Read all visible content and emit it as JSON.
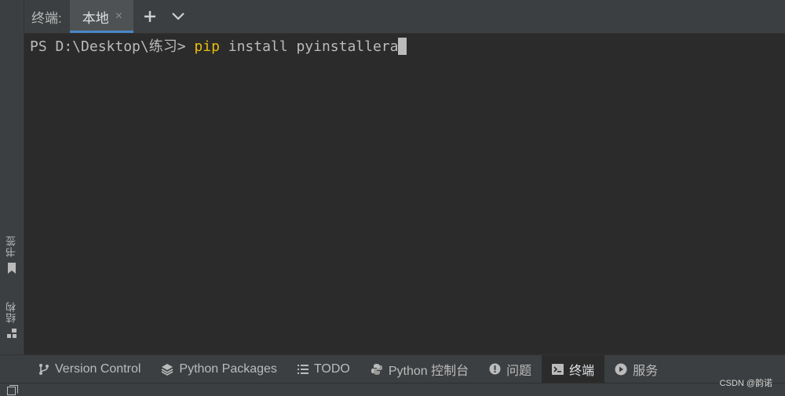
{
  "header": {
    "title": "终端:",
    "tab_label": "本地",
    "tab_close": "×"
  },
  "terminal": {
    "prompt": "PS D:\\Desktop\\练习> ",
    "command": "pip",
    "args": " install pyinstallera"
  },
  "left_tools": [
    {
      "label": "书签",
      "icon": "bookmark-icon"
    },
    {
      "label": "结构",
      "icon": "structure-icon"
    }
  ],
  "bottom_tools": [
    {
      "label": "Version Control",
      "icon": "version-control-icon"
    },
    {
      "label": "Python Packages",
      "icon": "layers-icon"
    },
    {
      "label": "TODO",
      "icon": "list-icon"
    },
    {
      "label": "Python 控制台",
      "icon": "python-icon"
    },
    {
      "label": "问题",
      "icon": "problems-icon"
    },
    {
      "label": "终端",
      "icon": "terminal-icon",
      "active": true
    },
    {
      "label": "服务",
      "icon": "services-icon"
    }
  ],
  "watermark": "CSDN @韵诺",
  "colors": {
    "background": "#2b2b2b",
    "chrome": "#3c3f41",
    "command": "#e8bf0d",
    "tab_underline": "#4a88c7"
  }
}
